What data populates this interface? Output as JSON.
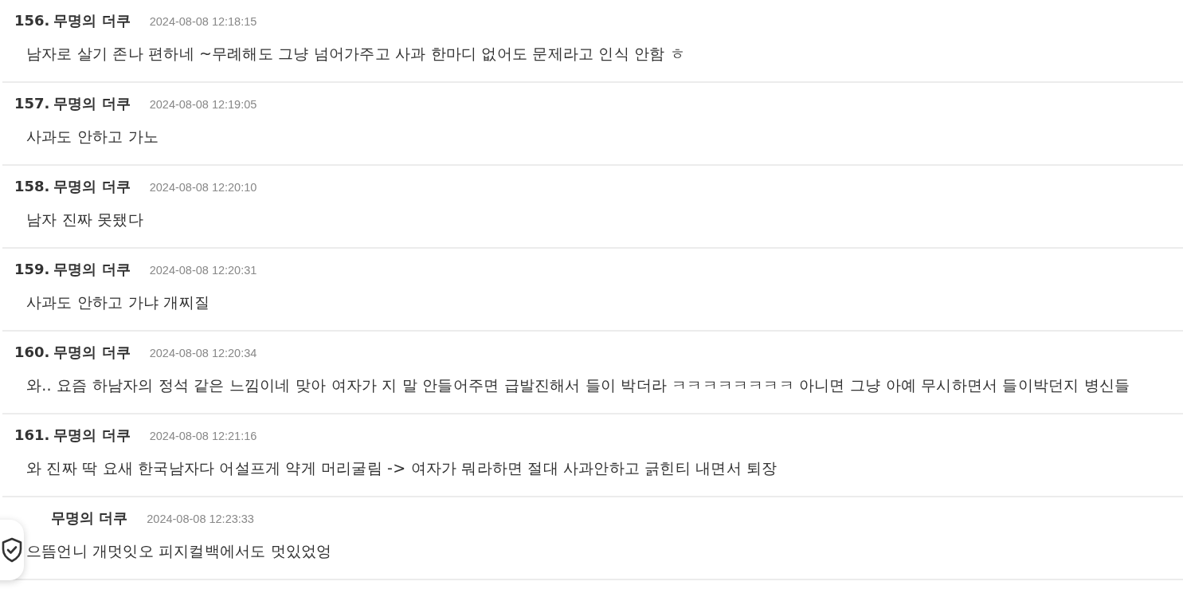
{
  "comments": [
    {
      "number": "156.",
      "author": "무명의 더쿠",
      "time": "2024-08-08 12:18:15",
      "text": "남자로 살기 존나 편하네 ~무례해도 그냥 넘어가주고 사과 한마디 없어도 문제라고 인식 안함 ㅎ"
    },
    {
      "number": "157.",
      "author": "무명의 더쿠",
      "time": "2024-08-08 12:19:05",
      "text": "사과도 안하고 가노"
    },
    {
      "number": "158.",
      "author": "무명의 더쿠",
      "time": "2024-08-08 12:20:10",
      "text": "남자 진짜 못됐다"
    },
    {
      "number": "159.",
      "author": "무명의 더쿠",
      "time": "2024-08-08 12:20:31",
      "text": "사과도 안하고 가냐 개찌질"
    },
    {
      "number": "160.",
      "author": "무명의 더쿠",
      "time": "2024-08-08 12:20:34",
      "text": "와.. 요즘 하남자의 정석 같은 느낌이네 맞아 여자가 지 말 안들어주면 급발진해서 들이 박더라 ㅋㅋㅋㅋㅋㅋㅋㅋ 아니면 그냥 아예 무시하면서 들이박던지 병신들"
    },
    {
      "number": "161.",
      "author": "무명의 더쿠",
      "time": "2024-08-08 12:21:16",
      "text": "와 진짜 딱 요새 한국남자다 어설프게 약게 머리굴림 -> 여자가 뭐라하면 절대 사과안하고 긁힌티 내면서 퇴장"
    },
    {
      "author": "무명의 더쿠",
      "time": "2024-08-08 12:23:33",
      "text": "으뜸언니 개멋잇오 피지컬백에서도 멋있었엉"
    }
  ]
}
